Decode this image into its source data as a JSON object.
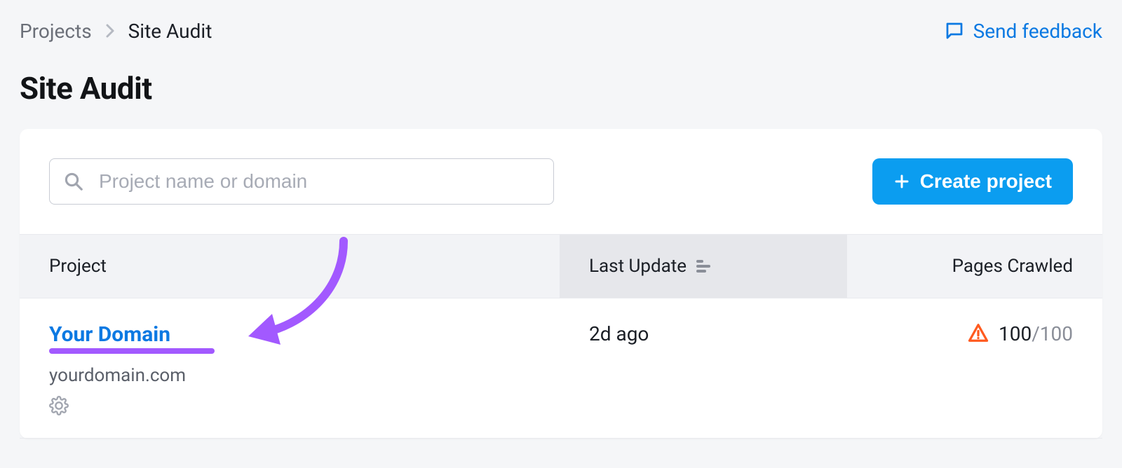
{
  "breadcrumb": {
    "root": "Projects",
    "current": "Site Audit"
  },
  "feedback": {
    "label": "Send feedback"
  },
  "pageTitle": "Site Audit",
  "search": {
    "placeholder": "Project name or domain"
  },
  "buttons": {
    "create": "Create project"
  },
  "table": {
    "headers": {
      "project": "Project",
      "lastUpdate": "Last Update",
      "pagesCrawled": "Pages Crawled"
    },
    "rows": [
      {
        "name": "Your Domain",
        "domain": "yourdomain.com",
        "lastUpdate": "2d ago",
        "pagesCrawled": "100",
        "pagesTotal": "/100"
      }
    ]
  },
  "colors": {
    "accentPurple": "#a259ff",
    "primaryBlue": "#0b79e2",
    "buttonBlue": "#0b9df0",
    "warnOrange": "#ff5a1f"
  }
}
